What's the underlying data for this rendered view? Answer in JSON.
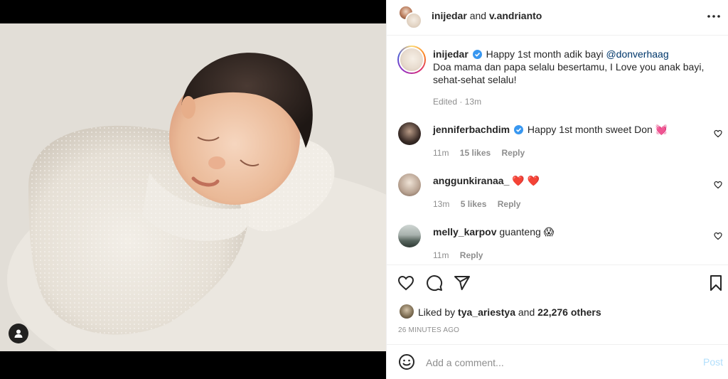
{
  "header": {
    "user1": "inijedar",
    "joiner": "and",
    "user2": "v.andrianto"
  },
  "caption": {
    "username": "inijedar",
    "text_before_mention": "Happy 1st month adik bayi",
    "mention": "@donverhaag",
    "body": "Doa mama dan papa selalu besertamu, I Love you anak bayi, sehat-sehat selalu!",
    "edited": "Edited",
    "separator": "·",
    "time": "13m"
  },
  "comments": [
    {
      "username": "jenniferbachdim",
      "verified": true,
      "text": "Happy 1st month sweet Don",
      "emoji": "💓",
      "time": "11m",
      "likes": "15 likes",
      "reply": "Reply"
    },
    {
      "username": "anggunkiranaa_",
      "verified": false,
      "text": "",
      "emoji": "❤️ ❤️",
      "time": "13m",
      "likes": "5 likes",
      "reply": "Reply"
    },
    {
      "username": "melly_karpov",
      "verified": false,
      "text": "guanteng",
      "emoji": "😱",
      "time": "11m",
      "likes": "",
      "reply": "Reply"
    }
  ],
  "likes": {
    "prefix": "Liked by",
    "user": "tya_ariestya",
    "and": "and",
    "count": "22,276 others"
  },
  "timestamp": "26 MINUTES AGO",
  "add_comment": {
    "placeholder": "Add a comment...",
    "post_label": "Post"
  },
  "colors": {
    "verified": "#3897f0",
    "mention": "#00376b",
    "post_disabled": "#b2dffc",
    "muted": "#8e8e8e"
  },
  "icons": [
    "more-icon",
    "heart-icon",
    "comment-icon",
    "share-icon",
    "bookmark-icon",
    "emoji-icon",
    "user-tag-icon",
    "verified-icon"
  ]
}
